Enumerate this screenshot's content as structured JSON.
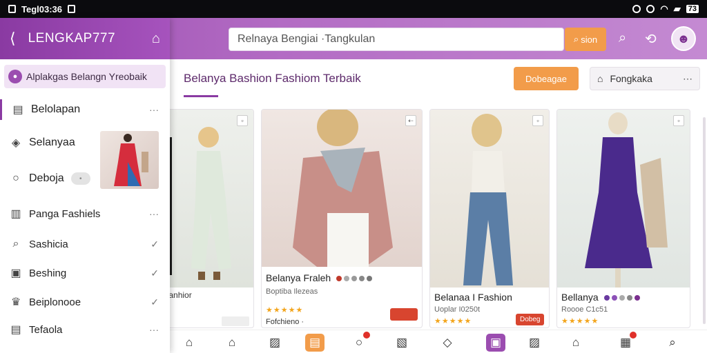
{
  "status_bar": {
    "left_text": "Tegl03:36",
    "battery": "73"
  },
  "appbar": {
    "search_value": "Relnaya Bengiai ·Tangkulan",
    "search_button": "sion",
    "brand_color": "#9b4db0"
  },
  "drawer": {
    "title": "LENGKAP777",
    "chip": "Alplakgas Belangn Yreobaik",
    "items": [
      {
        "label": "Belolapan",
        "icon": "dashboard-icon",
        "trail": "···"
      },
      {
        "label": "Selanyaa",
        "icon": "tag-icon",
        "trail": ""
      },
      {
        "label": "Deboja",
        "icon": "chat-icon",
        "trail": ""
      },
      {
        "label": "Panga Fashiels",
        "icon": "store-icon",
        "trail": "···"
      },
      {
        "label": "Sashicia",
        "icon": "search-icon",
        "trail": "✓"
      },
      {
        "label": "Beshing",
        "icon": "image-icon",
        "trail": "✓"
      },
      {
        "label": "Beiplonooe",
        "icon": "crown-icon",
        "trail": "✓"
      },
      {
        "label": "Tefaola",
        "icon": "list-icon",
        "trail": "···"
      }
    ]
  },
  "content": {
    "heading": "Belanya Bashion Fashiom Terbaik",
    "primary_button": "Dobeagae",
    "select_value": "Fongkaka"
  },
  "cards": [
    {
      "name": "",
      "sub": "Aepanhior",
      "stars": "",
      "price": ""
    },
    {
      "name": "Belanya Fraleh",
      "sub": "Boptiba Ilezeas",
      "stars": "★★★★★",
      "extra": "Fofchieno ·",
      "price": ""
    },
    {
      "name": "Belanaa I Fashion",
      "sub": "Uoplar I0250t",
      "stars": "★★★★★",
      "price": "Dobeg"
    },
    {
      "name": "Bellanya",
      "sub": "Roooe C1c51",
      "stars": "★★★★★",
      "price": ""
    }
  ],
  "accent_orange": "#f29c4a",
  "accent_red": "#d8452f"
}
